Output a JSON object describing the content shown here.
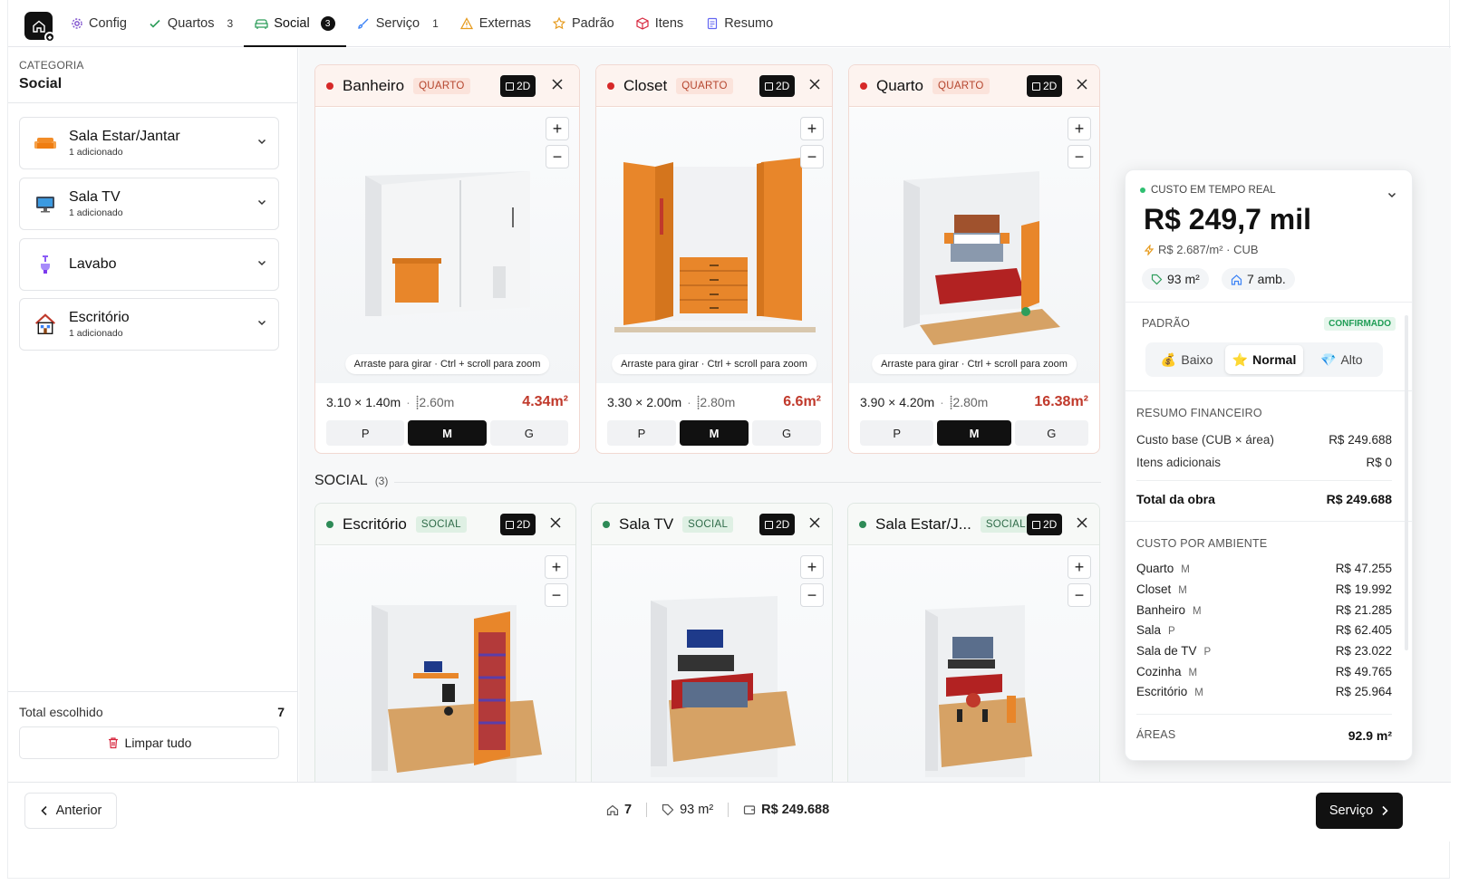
{
  "nav": {
    "tabs": [
      {
        "label": "Config",
        "count": "",
        "icon": "gear-icon"
      },
      {
        "label": "Quartos",
        "count": "3",
        "icon": "check-icon"
      },
      {
        "label": "Social",
        "count": "3",
        "icon": "sofa-icon"
      },
      {
        "label": "Serviço",
        "count": "1",
        "icon": "brush-icon"
      },
      {
        "label": "Externas",
        "count": "",
        "icon": "warning-icon"
      },
      {
        "label": "Padrão",
        "count": "",
        "icon": "star-badge-icon"
      },
      {
        "label": "Itens",
        "count": "",
        "icon": "box-icon"
      },
      {
        "label": "Resumo",
        "count": "",
        "icon": "document-icon"
      }
    ]
  },
  "sidebar": {
    "category_label": "CATEGORIA",
    "category_value": "Social",
    "items": [
      {
        "title": "Sala Estar/Jantar",
        "subtitle": "1 adicionado",
        "icon": "sofa-icon"
      },
      {
        "title": "Sala TV",
        "subtitle": "1 adicionado",
        "icon": "tv-icon"
      },
      {
        "title": "Lavabo",
        "subtitle": "",
        "icon": "faucet-icon"
      },
      {
        "title": "Escritório",
        "subtitle": "1 adicionado",
        "icon": "house-icon"
      }
    ],
    "total_label": "Total escolhido",
    "total_value": "7",
    "clear_label": "Limpar tudo"
  },
  "main": {
    "hint": "Arraste para girar · Ctrl + scroll para zoom",
    "btn_2d": "2D",
    "sizes": [
      "P",
      "M",
      "G"
    ],
    "quarto_cards": [
      {
        "name": "Banheiro",
        "tag": "QUARTO",
        "dims": "3.10 × 1.40m",
        "height": "2.60m",
        "area": "4.34m²",
        "size": "M"
      },
      {
        "name": "Closet",
        "tag": "QUARTO",
        "dims": "3.30 × 2.00m",
        "height": "2.80m",
        "area": "6.6m²",
        "size": "M"
      },
      {
        "name": "Quarto",
        "tag": "QUARTO",
        "dims": "3.90 × 4.20m",
        "height": "2.80m",
        "area": "16.38m²",
        "size": "M"
      }
    ],
    "section": {
      "title": "SOCIAL",
      "count": "(3)"
    },
    "social_cards": [
      {
        "name": "Escritório",
        "tag": "SOCIAL"
      },
      {
        "name": "Sala TV",
        "tag": "SOCIAL"
      },
      {
        "name": "Sala Estar/J...",
        "tag": "SOCIAL"
      }
    ]
  },
  "cost": {
    "live_label": "CUSTO EM TEMPO REAL",
    "total": "R$ 249,7 mil",
    "per_m2": "R$ 2.687/m² · CUB",
    "area_pill": "93 m²",
    "rooms_pill": "7 amb.",
    "padrao_label": "PADRÃO",
    "confirmed": "CONFIRMADO",
    "options": [
      "Baixo",
      "Normal",
      "Alto"
    ],
    "selected_option": "Normal",
    "fin_label": "RESUMO FINANCEIRO",
    "fin_rows": [
      {
        "label": "Custo base (CUB × área)",
        "value": "R$ 249.688"
      },
      {
        "label": "Itens adicionais",
        "value": "R$ 0"
      }
    ],
    "total_label": "Total da obra",
    "total_value": "R$ 249.688",
    "amb_label": "CUSTO POR AMBIENTE",
    "ambientes": [
      {
        "name": "Quarto",
        "size": "M",
        "value": "R$ 47.255"
      },
      {
        "name": "Closet",
        "size": "M",
        "value": "R$ 19.992"
      },
      {
        "name": "Banheiro",
        "size": "M",
        "value": "R$ 21.285"
      },
      {
        "name": "Sala",
        "size": "P",
        "value": "R$ 62.405"
      },
      {
        "name": "Sala de TV",
        "size": "P",
        "value": "R$ 23.022"
      },
      {
        "name": "Cozinha",
        "size": "M",
        "value": "R$ 49.765"
      },
      {
        "name": "Escritório",
        "size": "M",
        "value": "R$ 25.964"
      }
    ],
    "areas_label": "ÁREAS",
    "areas_value": "92.9 m²"
  },
  "footer": {
    "prev_label": "Anterior",
    "rooms": "7",
    "area": "93 m²",
    "total": "R$ 249.688",
    "next_label": "Serviço"
  }
}
